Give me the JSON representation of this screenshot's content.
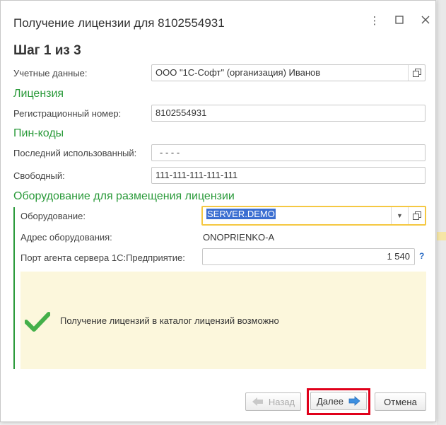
{
  "window": {
    "title": "Получение лицензии для 8102554931",
    "step": "Шаг 1 из 3"
  },
  "credentials": {
    "label": "Учетные данные:",
    "value": "ООО \"1С-Софт\" (организация) Иванов"
  },
  "license": {
    "section": "Лицензия",
    "reg_label": "Регистрационный номер:",
    "reg_value": "8102554931"
  },
  "pins": {
    "section": "Пин-коды",
    "last_label": "Последний использованный:",
    "last_value": "-  -  -  -",
    "free_label": "Свободный:",
    "free_value": "111-111-111-111-111"
  },
  "hardware": {
    "section": "Оборудование для размещения лицензии",
    "equip_label": "Оборудование:",
    "equip_value": "SERVER.DEMO",
    "addr_label": "Адрес оборудования:",
    "addr_value": "ONOPRIENKO-A",
    "port_label": "Порт агента сервера 1С:Предприятие:",
    "port_value": "1 540",
    "help": "?"
  },
  "info": {
    "message": "Получение лицензий в каталог лицензий возможно"
  },
  "buttons": {
    "back": "Назад",
    "next": "Далее",
    "cancel": "Отмена"
  },
  "colors": {
    "accent_green": "#2a9a3a",
    "info_bg": "#fcf7dc",
    "focus_border": "#f5c842",
    "highlight": "#e0001a"
  }
}
